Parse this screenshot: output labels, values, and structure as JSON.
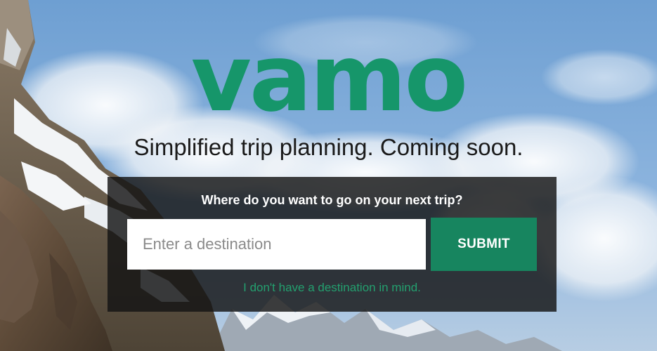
{
  "brand": {
    "logo_text": "vamo",
    "tagline": "Simplified trip planning. Coming soon."
  },
  "search": {
    "heading": "Where do you want to go on your next trip?",
    "placeholder": "Enter a destination",
    "value": "",
    "submit_label": "SUBMIT",
    "no_destination_link": "I don't have a destination in mind."
  },
  "colors": {
    "brand_green": "#16966a",
    "button_green": "#17855f",
    "link_green": "#23a06f",
    "panel_background": "#141414",
    "sky_blue": "#6f9fd0"
  }
}
